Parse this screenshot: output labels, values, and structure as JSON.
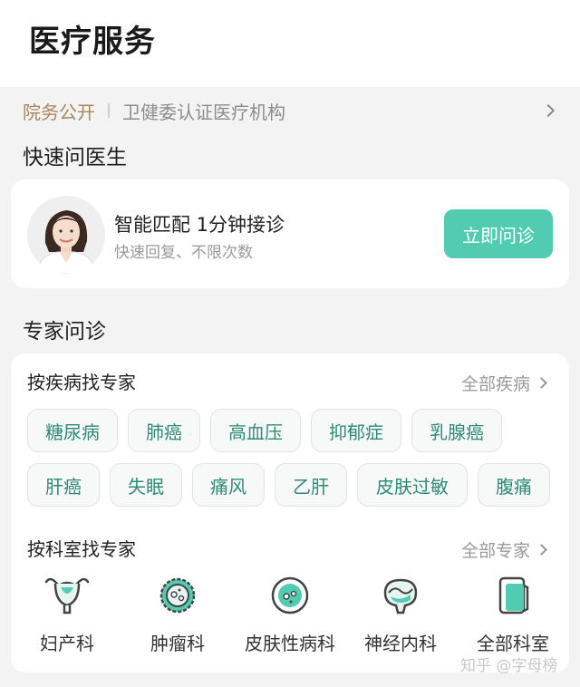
{
  "header": {
    "title": "医疗服务"
  },
  "notice": {
    "tag": "院务公开",
    "text": "卫健委认证医疗机构"
  },
  "quick_consult": {
    "section_title": "快速问医生",
    "main_text": "智能匹配 1分钟接诊",
    "sub_text": "快速回复、不限次数",
    "button_label": "立即问诊",
    "accent_color": "#52ccb0"
  },
  "expert": {
    "section_title": "专家问诊",
    "by_disease": {
      "title": "按疾病找专家",
      "more_label": "全部疾病",
      "row1": [
        "糖尿病",
        "肺癌",
        "高血压",
        "抑郁症",
        "乳腺癌"
      ],
      "row2": [
        "肝癌",
        "失眠",
        "痛风",
        "乙肝",
        "皮肤过敏",
        "腹痛"
      ]
    },
    "by_department": {
      "title": "按科室找专家",
      "more_label": "全部专家",
      "items": [
        {
          "label": "妇产科",
          "icon": "uterus-icon"
        },
        {
          "label": "肿瘤科",
          "icon": "tumor-cell-icon"
        },
        {
          "label": "皮肤性病科",
          "icon": "skin-cell-icon"
        },
        {
          "label": "神经内科",
          "icon": "brain-icon"
        },
        {
          "label": "全部科室",
          "icon": "document-icon"
        }
      ]
    }
  },
  "watermark": "知乎 @字母榜"
}
